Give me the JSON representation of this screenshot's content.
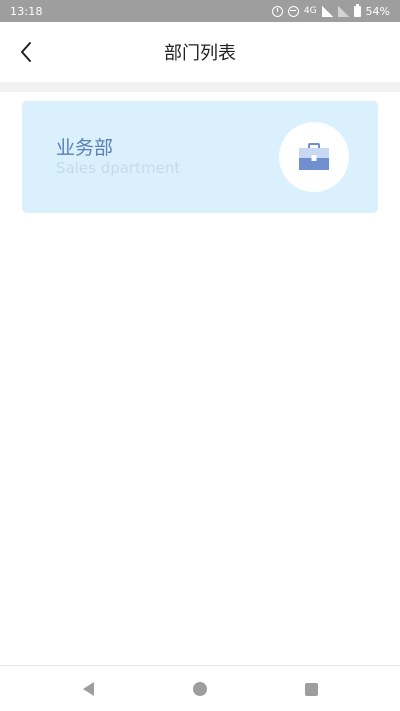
{
  "status_bar": {
    "time": "13:18",
    "network": "4G",
    "battery": "54%"
  },
  "header": {
    "title": "部门列表",
    "back_icon": "chevron-left-icon"
  },
  "departments": [
    {
      "name": "业务部",
      "subtitle": "Sales dpartment",
      "icon": "briefcase-icon"
    }
  ],
  "nav_bar": {
    "back_icon": "triangle-back-icon",
    "home_icon": "circle-home-icon",
    "recent_icon": "square-recents-icon"
  },
  "colors": {
    "status_bar_bg": "#9e9e9e",
    "card_bg": "#daf0fd",
    "card_title": "#5b7fb6",
    "card_subtitle": "#c2dbee",
    "icon_accent": "#6f8fcf"
  }
}
